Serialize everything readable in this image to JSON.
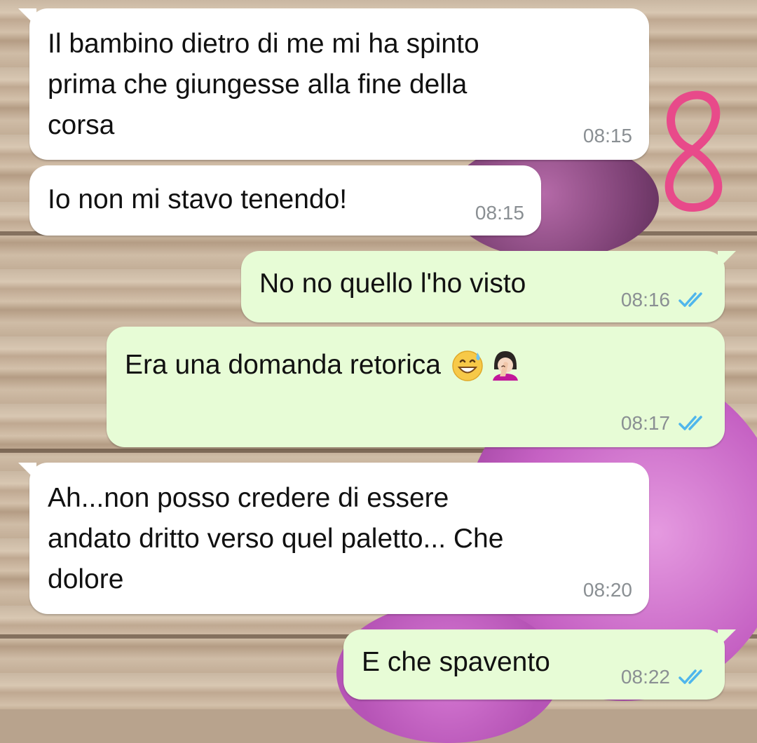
{
  "messages": [
    {
      "direction": "incoming",
      "text": "Il bambino dietro di me mi ha spinto\nprima che giungesse alla fine della\ncorsa",
      "time": "08:15"
    },
    {
      "direction": "incoming",
      "text": "Io non mi stavo tenendo!",
      "time": "08:15"
    },
    {
      "direction": "outgoing",
      "text": "No no quello l'ho visto",
      "time": "08:16",
      "status": "read"
    },
    {
      "direction": "outgoing",
      "text": "Era una domanda retorica",
      "time": "08:17",
      "status": "read",
      "emojis": [
        "grinning-sweat-emoji",
        "woman-facepalming-emoji"
      ]
    },
    {
      "direction": "incoming",
      "text": "Ah...non posso credere di essere\nandato dritto verso quel paletto... Che\ndolore",
      "time": "08:20"
    },
    {
      "direction": "outgoing",
      "text": "E che spavento",
      "time": "08:22",
      "status": "read"
    }
  ],
  "colors": {
    "incoming_bubble": "#ffffff",
    "outgoing_bubble": "#e7fcd6",
    "read_ticks": "#4fb6ec",
    "timestamp": "#8a8f93",
    "doodle": "#e84a8a"
  }
}
